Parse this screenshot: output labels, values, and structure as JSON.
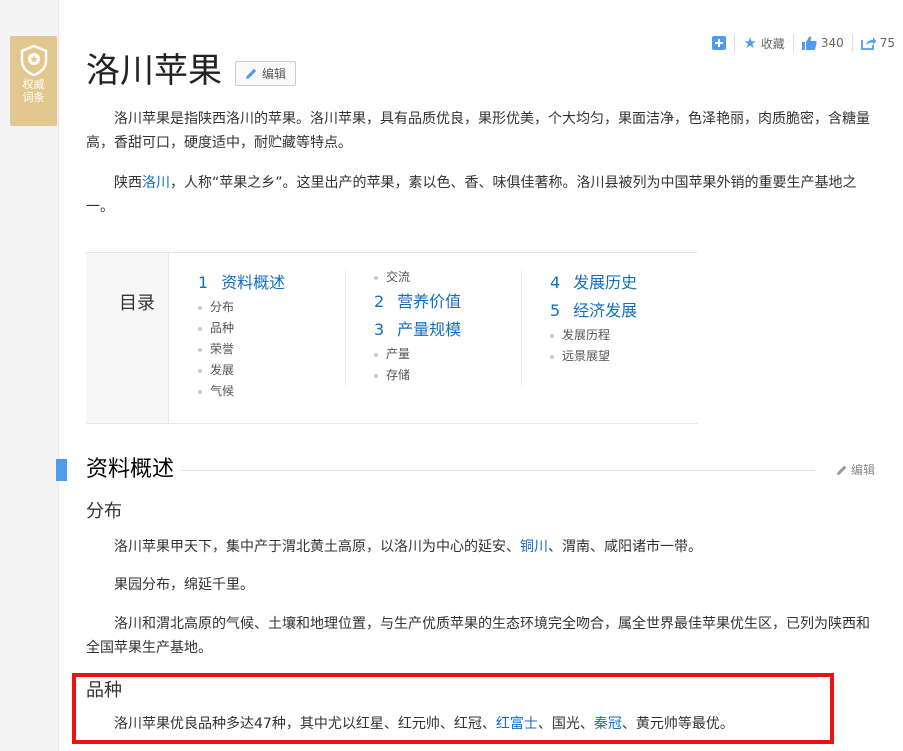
{
  "badge": {
    "text_line1": "权威",
    "text_line2": "词条"
  },
  "toolbar": {
    "favorite_label": "收藏",
    "like_count": "340",
    "share_count": "75"
  },
  "title": "洛川苹果",
  "edit_label": "编辑",
  "intro": {
    "p1": "洛川苹果是指陕西洛川的苹果。洛川苹果，具有品质优良，果形优美，个大均匀，果面洁净，色泽艳丽，肉质脆密，含糖量高，香甜可口，硬度适中，耐贮藏等特点。",
    "p2_before": "陕西",
    "p2_link": "洛川",
    "p2_after": "，人称“苹果之乡”。这里出产的苹果，素以色、香、味俱佳著称。洛川县被列为中国苹果外销的重要生产基地之一。"
  },
  "toc": {
    "label": "目录",
    "col1": {
      "num": "1",
      "title": "资料概述",
      "subs": [
        "分布",
        "品种",
        "荣誉",
        "发展",
        "气候"
      ]
    },
    "col2": {
      "lead_sub": "交流",
      "items": [
        {
          "num": "2",
          "title": "营养价值",
          "subs": []
        },
        {
          "num": "3",
          "title": "产量规模",
          "subs": [
            "产量",
            "存储"
          ]
        }
      ]
    },
    "col3": {
      "items": [
        {
          "num": "4",
          "title": "发展历史",
          "subs": []
        },
        {
          "num": "5",
          "title": "经济发展",
          "subs": [
            "发展历程",
            "远景展望"
          ]
        }
      ]
    }
  },
  "section1": {
    "title": "资料概述",
    "edit_label": "编辑",
    "distribution": {
      "title": "分布",
      "p1_before": "洛川苹果甲天下，集中产于渭北黄土高原，以洛川为中心的延安、",
      "p1_link": "铜川",
      "p1_after": "、渭南、咸阳诸市一带。",
      "p2": "果园分布，绵延千里。",
      "p3": "洛川和渭北高原的气候、土壤和地理位置，与生产优质苹果的生态环境完全吻合，属全世界最佳苹果优生区，已列为陕西和全国苹果生产基地。"
    },
    "variety": {
      "title": "品种",
      "p1_before": "洛川苹果优良品种多达47种，其中尤以红星、红元帅、红冠、",
      "p1_link1": "红富士",
      "p1_mid": "、国光、",
      "p1_link2": "秦冠",
      "p1_after": "、黄元帅等最优。"
    }
  },
  "colors": {
    "accent": "#4f9cee",
    "link": "#136ec2",
    "highlight": "#ee1111",
    "badge": "#e2c88e"
  }
}
